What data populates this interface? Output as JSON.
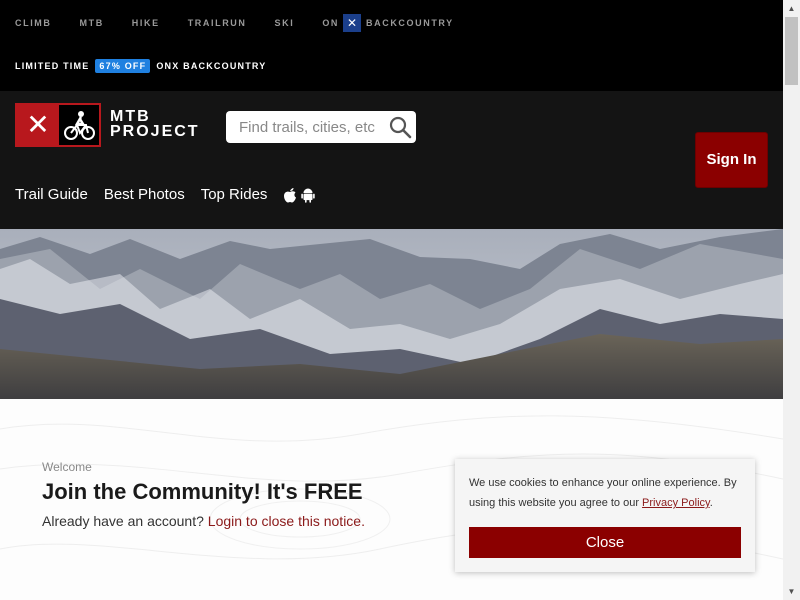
{
  "site_nav": {
    "items": [
      "CLIMB",
      "MTB",
      "HIKE",
      "TRAILRUN",
      "SKI"
    ],
    "onx_prefix": "ON",
    "onx_mark": "✕",
    "onx_suffix": "BACKCOUNTRY"
  },
  "promo": {
    "limited": "LIMITED TIME",
    "badge": "67% OFF",
    "product": "ONX BACKCOUNTRY"
  },
  "header": {
    "logo_line1": "MTB",
    "logo_line2": "PROJECT",
    "logo_mark": "✕",
    "search_placeholder": "Find trails, cities, etc",
    "signin_label": "Sign In"
  },
  "main_nav": {
    "items": [
      "Trail Guide",
      "Best Photos",
      "Top Rides"
    ],
    "app_icons": [
      "apple-icon",
      "android-icon"
    ]
  },
  "welcome": {
    "eyebrow": "Welcome",
    "title": "Join the Community! It's FREE",
    "already_text": "Already have an account? ",
    "login_link": "Login to close this notice."
  },
  "cookie": {
    "text_before": "We use cookies to enhance your online experience. By using this website you agree to our ",
    "policy_link": "Privacy Policy",
    "text_after": ".",
    "close_label": "Close"
  },
  "colors": {
    "brand_red": "#8b0000",
    "promo_blue": "#1f80e0",
    "onx_blue": "#1b3f8b"
  }
}
